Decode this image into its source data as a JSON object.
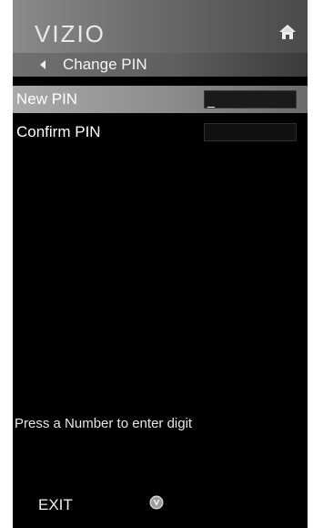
{
  "header": {
    "brand": "VIZIO",
    "home_icon": "home-icon"
  },
  "nav": {
    "back_icon": "back-arrow-icon",
    "title": "Change PIN"
  },
  "menu": {
    "items": [
      {
        "label": "New PIN",
        "value": "_"
      },
      {
        "label": "Confirm PIN",
        "value": ""
      }
    ]
  },
  "hint": "Press a Number to enter digit",
  "footer": {
    "exit_label": "EXIT",
    "button_icon": "v-button-icon"
  }
}
